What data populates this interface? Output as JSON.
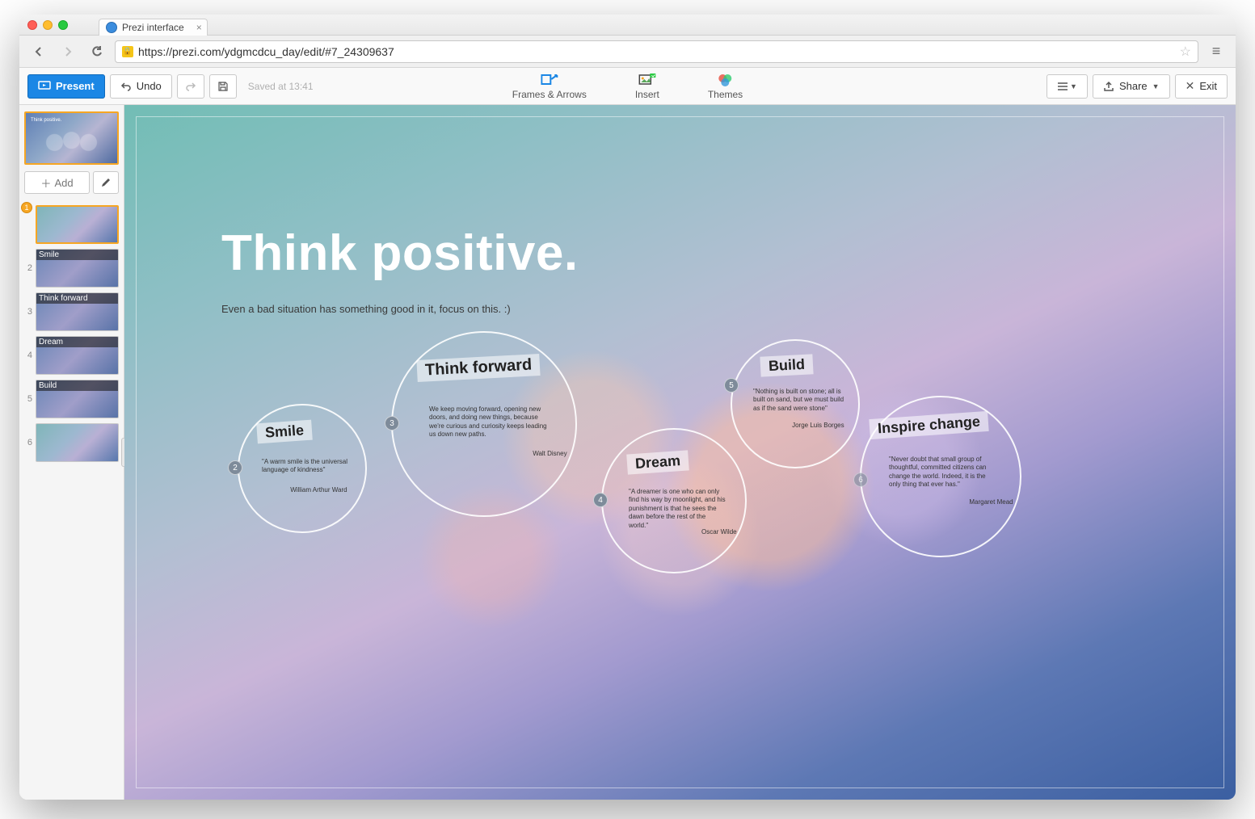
{
  "browser": {
    "tab_title": "Prezi interface",
    "url": "https://prezi.com/ydgmcdcu_day/edit/#7_24309637"
  },
  "toolbar": {
    "present": "Present",
    "undo": "Undo",
    "status": "Saved at 13:41",
    "frames_arrows": "Frames & Arrows",
    "insert": "Insert",
    "themes": "Themes",
    "share": "Share",
    "exit": "Exit"
  },
  "sidebar": {
    "overview_title": "Think positive.",
    "add": "Add",
    "frames": [
      {
        "num": "1",
        "label": "",
        "selected": true
      },
      {
        "num": "2",
        "label": "Smile"
      },
      {
        "num": "3",
        "label": "Think forward"
      },
      {
        "num": "4",
        "label": "Dream"
      },
      {
        "num": "5",
        "label": "Build"
      },
      {
        "num": "6",
        "label": ""
      }
    ]
  },
  "canvas": {
    "title": "Think positive.",
    "subtitle": "Even a bad situation has something good in it, focus on this. :)",
    "bubbles": {
      "smile": {
        "step": "2",
        "label": "Smile",
        "body": "\"A warm smile is the universal language of kindness\"",
        "author": "William Arthur Ward"
      },
      "forward": {
        "step": "3",
        "label": "Think forward",
        "body": "We keep moving forward, opening new doors, and doing new things, because we're curious and curiosity keeps leading us down new paths.",
        "author": "Walt Disney"
      },
      "dream": {
        "step": "4",
        "label": "Dream",
        "body": "\"A dreamer is one who can only find his way by moonlight, and his punishment is that he sees the dawn before the rest of the world.\"",
        "author": "Oscar Wilde"
      },
      "build": {
        "step": "5",
        "label": "Build",
        "body": "\"Nothing is built on stone; all is built on sand, but we must build as if the sand were stone\"",
        "author": "Jorge Luis Borges"
      },
      "inspire": {
        "step": "6",
        "label": "Inspire change",
        "body": "\"Never doubt that small group of thoughtful, committed citizens can change the world. Indeed, it is the only thing that ever has.\"",
        "author": "Margaret Mead"
      }
    }
  }
}
